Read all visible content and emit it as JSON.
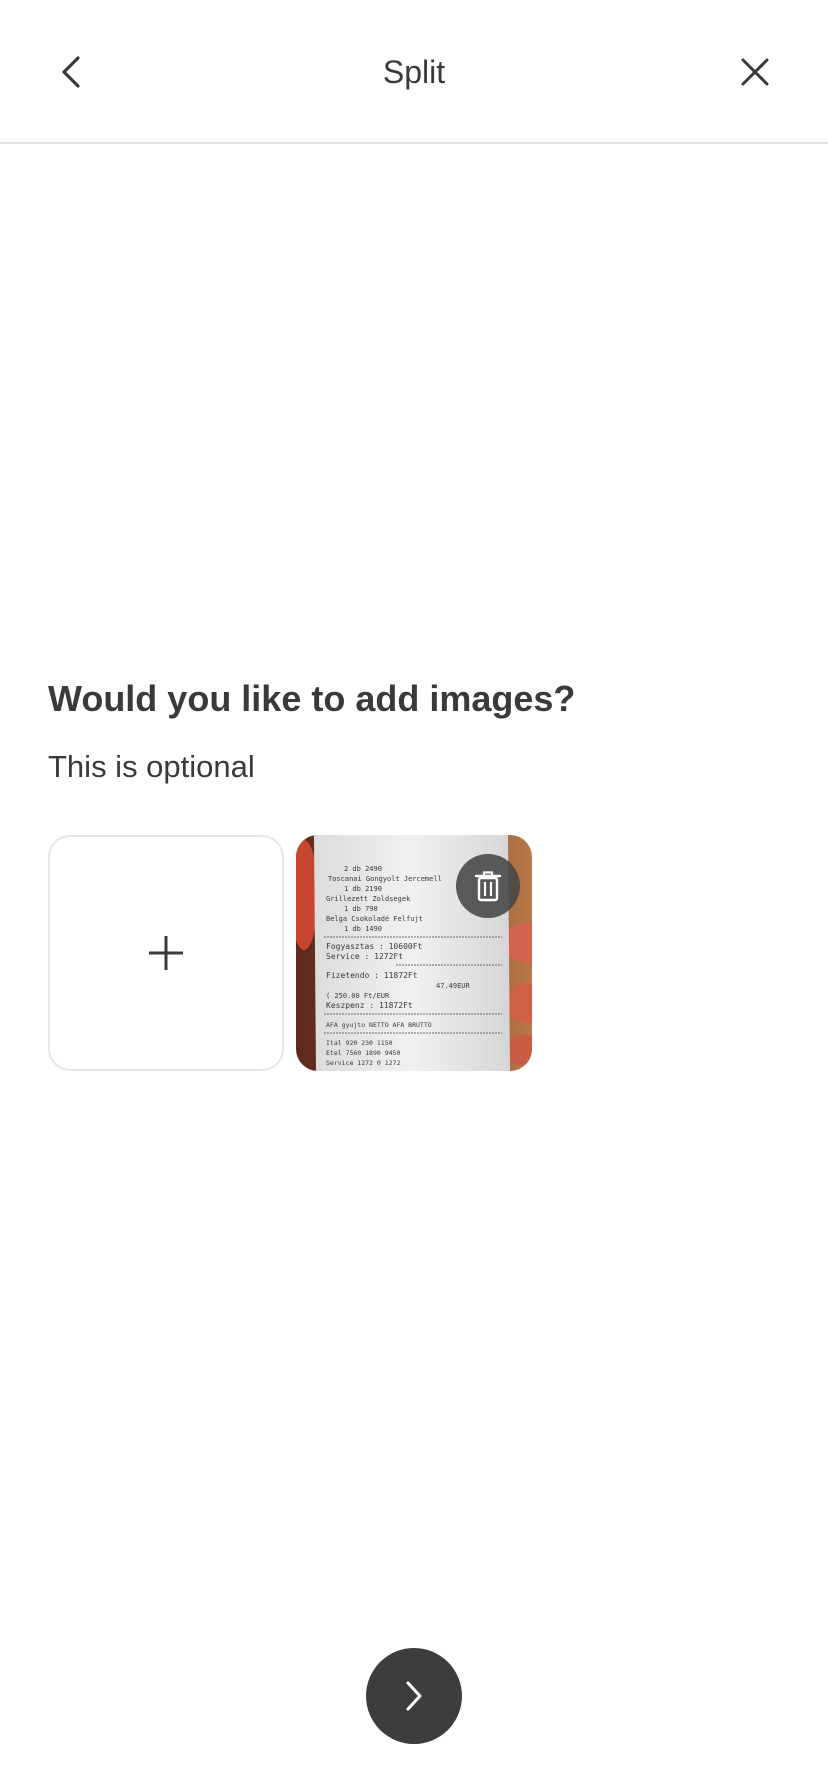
{
  "header": {
    "title": "Split",
    "back_icon": "chevron-left-icon",
    "close_icon": "close-icon"
  },
  "main": {
    "question": "Would you like to add images?",
    "subtitle": "This is optional",
    "add_icon": "plus-icon",
    "images": [
      {
        "kind": "receipt-photo",
        "delete_icon": "trash-icon",
        "receipt_text": [
          "2 db  2490",
          "Toscanai Gongyolt Jercemell",
          "1 db  2190",
          "Grillezett Zoldsegek",
          "1 db  790",
          "Belga Csokoladé Felfujt",
          "1 db  1490",
          "Fogyasztas  :  10600Ft",
          "Service  :  1272Ft",
          "Fizetendo  :  11872Ft",
          "47.49EUR",
          "( 250.00 Ft/EUR",
          "Keszpenz  :  11872Ft",
          "AFA gyujto  NETTO  AFA  BRUTTO",
          "Ital  920  230  1150",
          "Etel  7560  1890  9450",
          "Service  1272  0  1272"
        ]
      }
    ]
  },
  "footer": {
    "next_icon": "chevron-right-icon"
  },
  "colors": {
    "text": "#3a3a3a",
    "divider": "#e3e3e3",
    "tile_border": "#e6e6e6",
    "next_button": "#3d3d3d",
    "trash_button": "#464646"
  }
}
